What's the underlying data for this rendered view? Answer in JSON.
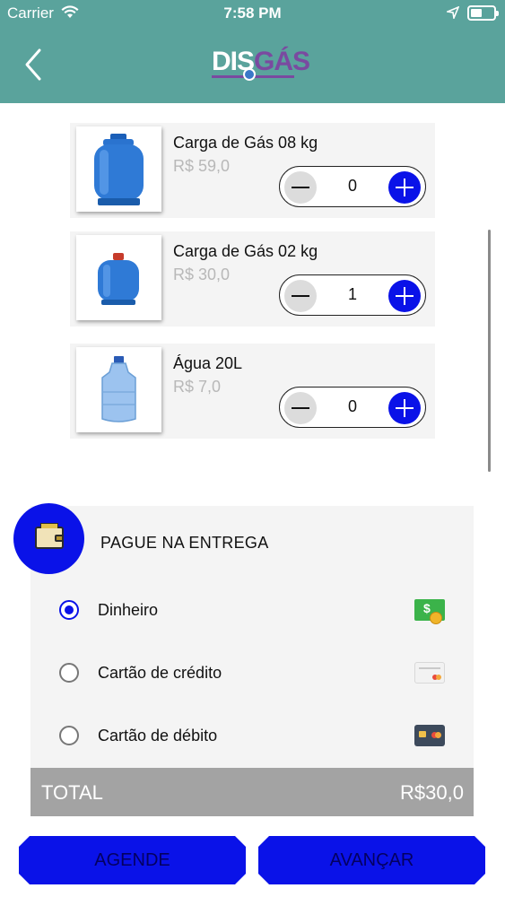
{
  "status_bar": {
    "carrier": "Carrier",
    "time": "7:58 PM"
  },
  "header": {
    "logo_part1": "DIS",
    "logo_part2": "GÁS",
    "back_icon": "chevron-left-icon"
  },
  "products": [
    {
      "name": "Carga de Gás 08 kg",
      "price": "R$ 59,0",
      "quantity": "0",
      "image": "gas-cylinder-blue-large"
    },
    {
      "name": "Carga de Gás 02 kg",
      "price": "R$ 30,0",
      "quantity": "1",
      "image": "gas-cylinder-blue-small"
    },
    {
      "name": "Água 20L",
      "price": "R$ 7,0",
      "quantity": "0",
      "image": "water-gallon"
    }
  ],
  "payment": {
    "title": "PAGUE NA ENTREGA",
    "options": [
      {
        "label": "Dinheiro",
        "selected": true,
        "icon": "cash-icon"
      },
      {
        "label": "Cartão de crédito",
        "selected": false,
        "icon": "credit-card-icon"
      },
      {
        "label": "Cartão de débito",
        "selected": false,
        "icon": "debit-card-icon"
      }
    ]
  },
  "total": {
    "label": "TOTAL",
    "value": "R$30,0"
  },
  "buttons": {
    "schedule": "AGENDE",
    "next": "AVANÇAR"
  },
  "colors": {
    "header_bg": "#5aa39c",
    "accent_blue": "#0a12e8",
    "logo_purple": "#7a4aa0",
    "total_bar": "#a3a3a3"
  }
}
